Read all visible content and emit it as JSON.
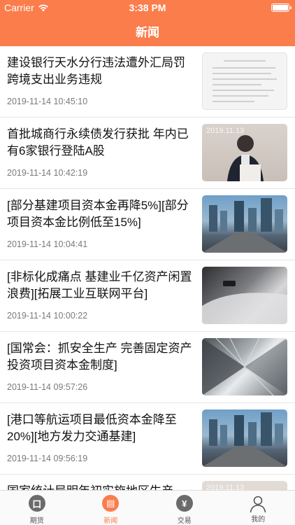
{
  "status_bar": {
    "carrier": "Carrier",
    "time": "3:38 PM"
  },
  "nav": {
    "title": "新闻"
  },
  "news": [
    {
      "title": "建设银行天水分行违法遭外汇局罚 跨境支出业务违规",
      "date": "2019-11-14 10:45:10",
      "image": "document"
    },
    {
      "title": "首批城商行永续债发行获批 年内已有6家银行登陆A股",
      "date": "2019-11-14 10:42:19",
      "image": "speaker",
      "image_caption": "2019.11.13"
    },
    {
      "title": "[部分基建项目资本金再降5%][部分项目资本金比例低至15%]",
      "date": "2019-11-14 10:04:41",
      "image": "city-skyline"
    },
    {
      "title": "[非标化成痛点 基建业千亿资产闲置浪费][拓展工业互联网平台]",
      "date": "2019-11-14 10:00:22",
      "image": "car"
    },
    {
      "title": "[国常会：抓安全生产 完善固定资产投资项目资本金制度]",
      "date": "2019-11-14 09:57:26",
      "image": "building-grid"
    },
    {
      "title": "[港口等航运项目最低资本金降至20%][地方发力交通基建]",
      "date": "2019-11-14 09:56:19",
      "image": "city-skyline"
    },
    {
      "title": "国家统计局明年初实施地区生产",
      "date": "",
      "image": "speaker",
      "image_caption": "2019.11.13"
    }
  ],
  "tabs": [
    {
      "label": "期货",
      "icon": "chat-icon",
      "glyph": "口",
      "active": false
    },
    {
      "label": "新闻",
      "icon": "news-icon",
      "glyph": "▤",
      "active": true
    },
    {
      "label": "交易",
      "icon": "yen-icon",
      "glyph": "¥",
      "active": false
    },
    {
      "label": "我的",
      "icon": "person-icon",
      "glyph": "",
      "active": false
    }
  ],
  "colors": {
    "accent": "#fb7d4c",
    "tab_inactive": "#555555",
    "separator": "#e6e6e6"
  }
}
